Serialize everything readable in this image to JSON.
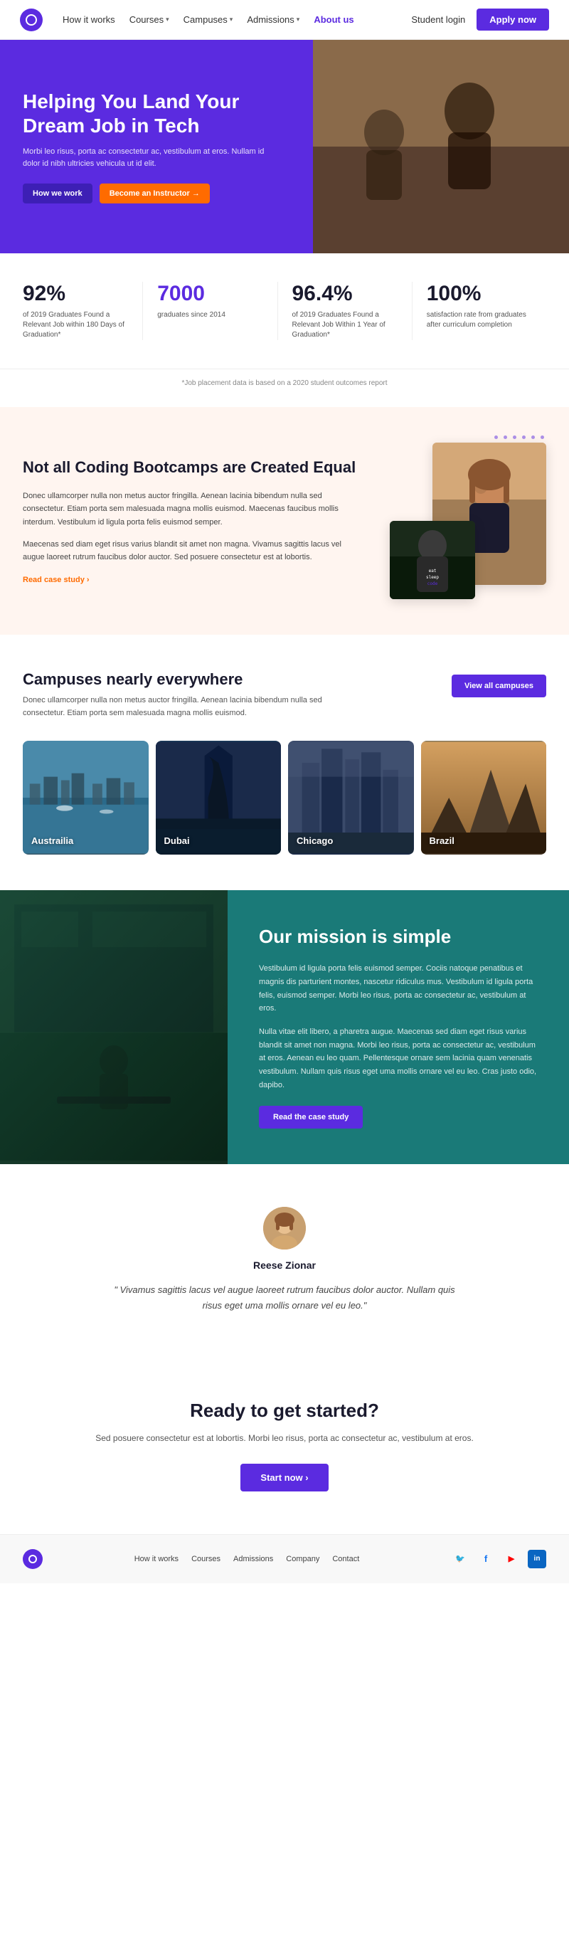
{
  "nav": {
    "logo_alt": "Logo",
    "links": [
      {
        "label": "How it works",
        "has_chevron": false
      },
      {
        "label": "Courses",
        "has_chevron": true
      },
      {
        "label": "Campuses",
        "has_chevron": true
      },
      {
        "label": "Admissions",
        "has_chevron": true
      },
      {
        "label": "About us",
        "has_chevron": false,
        "active": true
      }
    ],
    "student_login": "Student login",
    "apply_now": "Apply now"
  },
  "hero": {
    "title": "Helping You Land Your Dream Job in Tech",
    "subtitle": "Morbi leo risus, porta ac consectetur ac, vestibulum at eros. Nullam id dolor id nibh ultricies vehicula ut id elit.",
    "btn_how": "How we work",
    "btn_instructor": "Become an Instructor →"
  },
  "stats": [
    {
      "number": "92%",
      "desc": "of 2019 Graduates Found a Relevant Job within 180 Days of Graduation*"
    },
    {
      "number": "7000",
      "desc": "graduates since 2014"
    },
    {
      "number": "96.4%",
      "desc": "of 2019 Graduates Found a Relevant Job Within 1 Year of Graduation*"
    },
    {
      "number": "100%",
      "desc": "satisfaction rate from graduates after curriculum completion"
    }
  ],
  "stats_note": "*Job placement data is based on a 2020 student outcomes report",
  "bootcamp": {
    "title": "Not all Coding Bootcamps are Created Equal",
    "paragraph1": "Donec ullamcorper nulla non metus auctor fringilla. Aenean lacinia bibendum nulla sed consectetur. Etiam porta sem malesuada magna mollis euismod. Maecenas faucibus mollis interdum. Vestibulum id ligula porta felis euismod semper.",
    "paragraph2": "Maecenas sed diam eget risus varius blandit sit amet non magna. Vivamus sagittis lacus vel augue laoreet rutrum faucibus dolor auctor. Sed posuere consectetur est at lobortis.",
    "read_link": "Read case study ›"
  },
  "campuses": {
    "title": "Campuses nearly everywhere",
    "desc": "Donec ullamcorper nulla non metus auctor fringilla. Aenean lacinia bibendum nulla sed consectetur. Etiam porta sem malesuada magna mollis euismod.",
    "btn_view": "View all campuses",
    "cities": [
      {
        "name": "Austrailia",
        "bg_class": "campus-bg-1"
      },
      {
        "name": "Dubai",
        "bg_class": "campus-bg-2"
      },
      {
        "name": "Chicago",
        "bg_class": "campus-bg-3"
      },
      {
        "name": "Brazil",
        "bg_class": "campus-bg-4"
      }
    ]
  },
  "mission": {
    "title": "Our mission is simple",
    "paragraph1": "Vestibulum id ligula porta felis euismod semper. Cociis natoque penatibus et magnis dis parturient montes, nascetur ridiculus mus. Vestibulum id ligula porta felis, euismod semper. Morbi leo risus, porta ac consectetur ac, vestibulum at eros.",
    "paragraph2": "Nulla vitae elit libero, a pharetra augue. Maecenas sed diam eget risus varius blandit sit amet non magna. Morbi leo risus, porta ac consectetur ac, vestibulum at eros. Aenean eu leo quam. Pellentesque ornare sem lacinia quam venenatis vestibulum. Nullam quis risus eget uma mollis ornare vel eu leo. Cras justo odio, dapibo.",
    "btn_case_study": "Read the case study"
  },
  "testimonial": {
    "name": "Reese Zionar",
    "quote": "\" Vivamus sagittis lacus vel augue laoreet rutrum faucibus dolor auctor. Nullam quis risus eget uma mollis ornare vel eu leo.\""
  },
  "cta": {
    "title": "Ready to get started?",
    "desc": "Sed posuere consectetur est at lobortis. Morbi leo risus, porta ac consectetur ac, vestibulum at eros.",
    "btn_start": "Start now ›"
  },
  "footer": {
    "links": [
      "How it works",
      "Courses",
      "Admissions",
      "Company",
      "Contact"
    ],
    "social": [
      {
        "icon": "🐦",
        "name": "twitter",
        "label": "Twitter"
      },
      {
        "icon": "f",
        "name": "facebook",
        "label": "Facebook"
      },
      {
        "icon": "▶",
        "name": "youtube",
        "label": "YouTube"
      },
      {
        "icon": "in",
        "name": "linkedin",
        "label": "LinkedIn"
      }
    ]
  }
}
